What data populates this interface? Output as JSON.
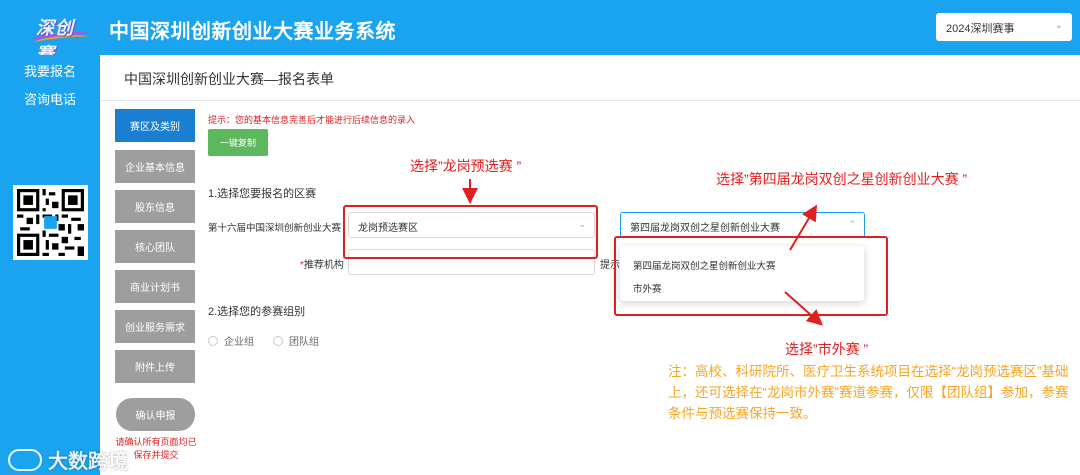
{
  "header": {
    "logo_text": "深创赛",
    "system_title": "中国深圳创新创业大赛业务系统",
    "year_select": {
      "value": "2024深圳赛事"
    }
  },
  "sidebar": {
    "links": [
      "我要报名",
      "咨询电话"
    ]
  },
  "form": {
    "title": "中国深圳创新创业大赛—报名表单",
    "steps": [
      "赛区及类别",
      "企业基本信息",
      "股东信息",
      "核心团队",
      "商业计划书",
      "创业服务需求",
      "附件上传"
    ],
    "active_step": 0,
    "confirm_label": "确认申报",
    "confirm_note": "请确认所有页面均已保存并提交",
    "tip": "提示：您的基本信息完善后才能进行后续信息的录入",
    "copy_button": "一键复制",
    "section1": "1.选择您要报名的区赛",
    "round_label": "第十六届中国深圳创新创业大赛",
    "region_select": "龙岗预选赛区",
    "contest_select": "第四届龙岗双创之星创新创业大赛",
    "recommend_label": "推荐机构",
    "hint_cut": "提示",
    "dropdown_options": [
      "第四届龙岗双创之星创新创业大赛",
      "市外赛"
    ],
    "section2": "2.选择您的参赛组别",
    "groups": [
      "企业组",
      "团队组"
    ]
  },
  "annotations": {
    "a1": "选择”龙岗预选赛 ”",
    "a2": "选择”第四届龙岗双创之星创新创业大赛 ”",
    "a3": "选择”市外赛 ”",
    "note": "注：高校、科研院所、医疗卫生系统项目在选择“龙岗预选赛区”基础上，还可选择在“龙岗市外赛”赛道参赛，仅限【团队组】参加，参赛条件与预选赛保持一致。"
  },
  "watermark": "大数跨境",
  "colors": {
    "header_blue": "#1aa3ee",
    "active_step": "#1a7fd0",
    "annotation_red": "#e02020",
    "note_orange": "#f5a623",
    "copy_green": "#5cb85c"
  }
}
